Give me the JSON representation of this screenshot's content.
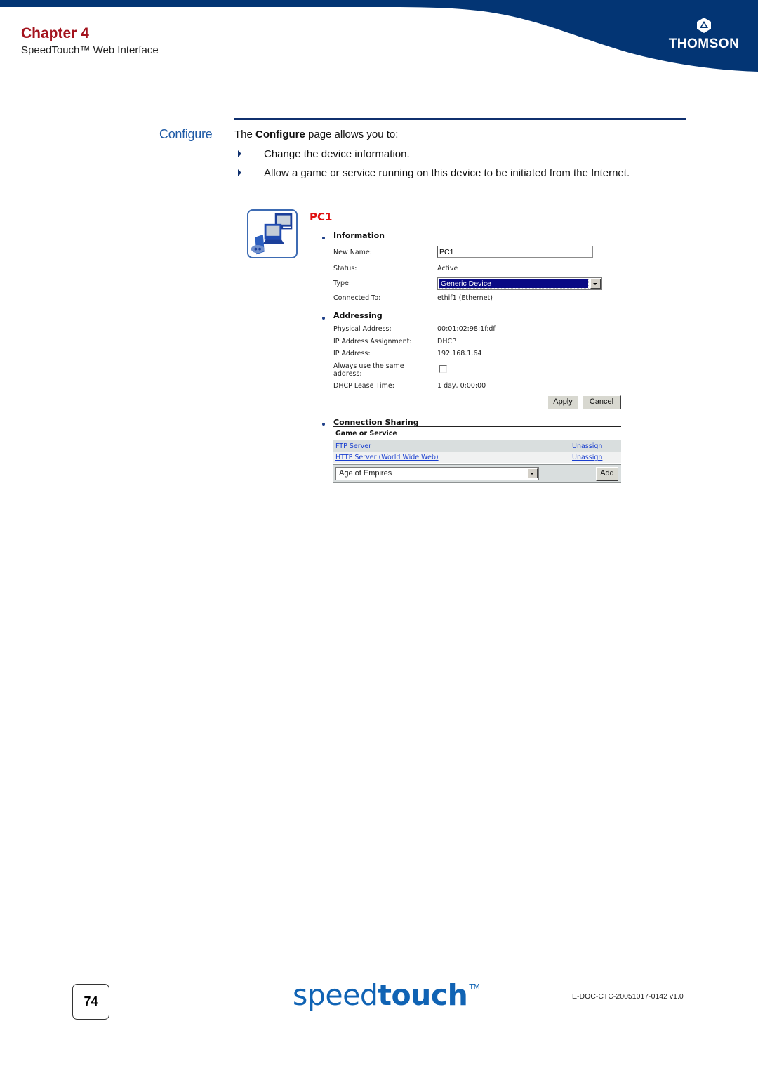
{
  "header": {
    "chapter": "Chapter 4",
    "subtitle": "SpeedTouch™ Web Interface",
    "brand": "THOMSON",
    "band_color": "#033574"
  },
  "section": {
    "side_title": "Configure",
    "intro_prefix": "The ",
    "intro_bold": "Configure",
    "intro_suffix": " page allows you to:",
    "bullets": [
      "Change the device information.",
      "Allow a game or service running on this device to be initiated from the Internet."
    ]
  },
  "device_page": {
    "device_title": "PC1",
    "device_icon": "pc-and-game-console-icon",
    "information": {
      "heading": "Information",
      "new_name_label": "New Name:",
      "new_name_value": "PC1",
      "status_label": "Status:",
      "status_value": "Active",
      "type_label": "Type:",
      "type_value": "Generic Device",
      "connected_to_label": "Connected To:",
      "connected_to_value": "ethif1 (Ethernet)"
    },
    "addressing": {
      "heading": "Addressing",
      "physical_address_label": "Physical Address:",
      "physical_address_value": "00:01:02:98:1f:df",
      "ip_assignment_label": "IP Address Assignment:",
      "ip_assignment_value": "DHCP",
      "ip_address_label": "IP Address:",
      "ip_address_value": "192.168.1.64",
      "always_same_label_line1": "Always use the same",
      "always_same_label_line2": "address:",
      "always_same_checked": false,
      "lease_time_label": "DHCP Lease Time:",
      "lease_time_value": "1 day, 0:00:00"
    },
    "buttons": {
      "apply": "Apply",
      "cancel": "Cancel"
    },
    "connection_sharing": {
      "heading": "Connection Sharing",
      "column_header": "Game or Service",
      "rows": [
        {
          "service": "FTP Server",
          "action": "Unassign"
        },
        {
          "service": "HTTP Server (World Wide Web)",
          "action": "Unassign"
        }
      ],
      "select_value": "Age of Empires",
      "add_button": "Add"
    }
  },
  "footer": {
    "page_number": "74",
    "logo_light": "speed",
    "logo_bold": "touch",
    "logo_tm": "TM",
    "doc_id": "E-DOC-CTC-20051017-0142 v1.0"
  }
}
